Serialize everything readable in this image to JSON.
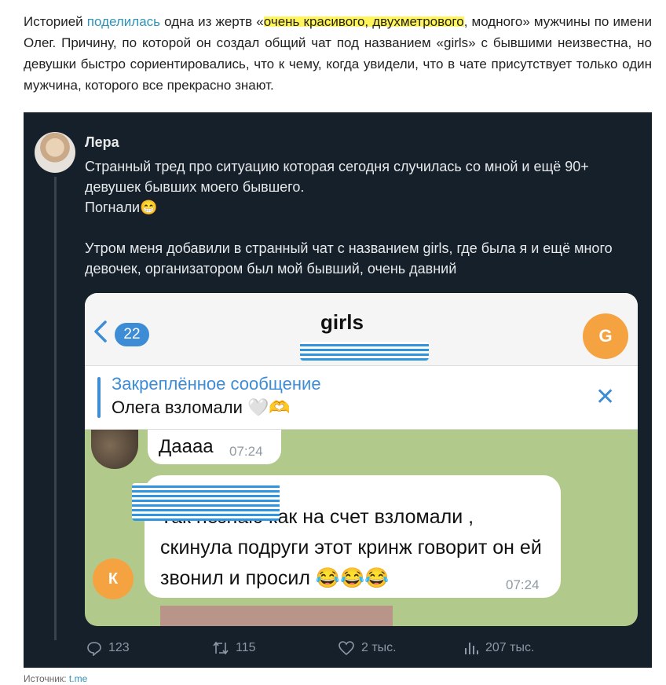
{
  "article": {
    "p_prefix": "Историей ",
    "link": "поделилась",
    "p_mid1": " одна из жертв «",
    "highlight": "очень красивого, двухметрового",
    "p_rest": ", модного» мужчины по имени Олег. Причину, по которой он создал общий чат под названием «girls» с бывшими неизвестна, но девушки быстро сориентировались, что к чему, когда увидели, что в чате присутствует только один мужчина, которого все прекрасно знают."
  },
  "tweet": {
    "author": "Лера",
    "line1": "Странный тред про ситуацию которая сегодня случилась со мной и ещё 90+ девушек бывших моего бывшего.",
    "line2": "Погнали😁",
    "line3": "Утром меня добавили в странный чат с названием girls, где была я и ещё много девочек, организатором был мой бывший, очень давний",
    "stats": {
      "replies": "123",
      "retweets": "115",
      "likes": "2 тыс.",
      "views": "207 тыс."
    }
  },
  "telegram": {
    "back_count": "22",
    "title": "girls",
    "avatar_letter": "G",
    "pinned_title": "Закреплённое сообщение",
    "pinned_text": "Олега взломали 🤍🫶",
    "msg1_text": "Даааа",
    "msg1_time": "07:24",
    "msg2_text": "Так незнаю как на счет взломали , скинула подруги этот кринж говорит он ей звонил и просил 😂😂😂",
    "msg2_time": "07:24",
    "msg2_avatar": "К"
  },
  "source": {
    "label": "Источник: ",
    "link": "t.me"
  },
  "colors": {
    "tweet_bg": "#15202b",
    "link": "#2f93b8",
    "highlight": "#fff45a",
    "tg_blue": "#3d8cd6",
    "avatar_orange": "#f5a340"
  }
}
